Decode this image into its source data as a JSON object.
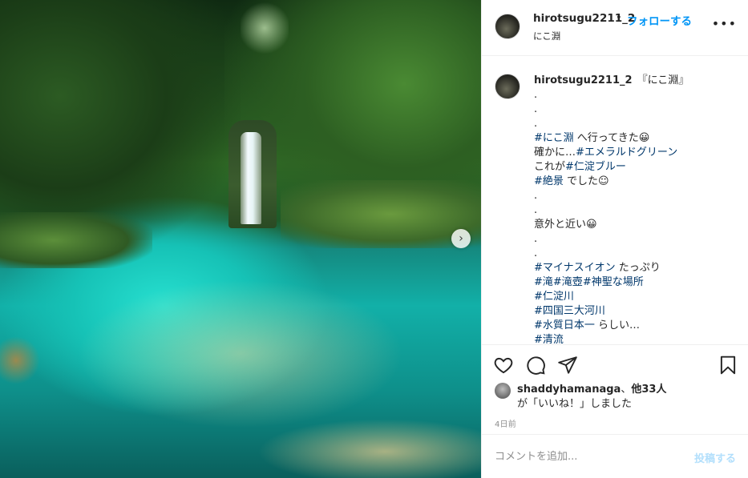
{
  "post": {
    "username": "hirotsugu2211_2",
    "separator": "•",
    "follow_label": "フォローする",
    "location": "にこ淵",
    "more_label": "•••",
    "next_label": "›"
  },
  "caption": {
    "username": "hirotsugu2211_2",
    "lines": [
      [
        {
          "t": "『にこ淵』",
          "tag": false
        }
      ],
      [
        {
          "t": ".",
          "tag": false
        }
      ],
      [
        {
          "t": ".",
          "tag": false
        }
      ],
      [
        {
          "t": ".",
          "tag": false
        }
      ],
      [
        {
          "t": "#にこ淵",
          "tag": true
        },
        {
          "t": " へ行ってきた😀",
          "tag": false
        }
      ],
      [
        {
          "t": "確かに…",
          "tag": false
        },
        {
          "t": "#エメラルドグリーン",
          "tag": true
        }
      ],
      [
        {
          "t": "これが",
          "tag": false
        },
        {
          "t": "#仁淀ブルー",
          "tag": true
        }
      ],
      [
        {
          "t": "#絶景",
          "tag": true
        },
        {
          "t": " でした☺",
          "tag": false
        }
      ],
      [
        {
          "t": ".",
          "tag": false
        }
      ],
      [
        {
          "t": ".",
          "tag": false
        }
      ],
      [
        {
          "t": "意外と近い😀",
          "tag": false
        }
      ],
      [
        {
          "t": ".",
          "tag": false
        }
      ],
      [
        {
          "t": ".",
          "tag": false
        }
      ],
      [
        {
          "t": "#マイナスイオン",
          "tag": true
        },
        {
          "t": " たっぷり",
          "tag": false
        }
      ],
      [
        {
          "t": "#滝",
          "tag": true
        },
        {
          "t": "#滝壺",
          "tag": true
        },
        {
          "t": "#神聖な場所",
          "tag": true
        }
      ],
      [
        {
          "t": "#仁淀川",
          "tag": true
        }
      ],
      [
        {
          "t": "#四国三大河川",
          "tag": true
        }
      ],
      [
        {
          "t": "#水質日本一",
          "tag": true
        },
        {
          "t": " らしい…",
          "tag": false
        }
      ],
      [
        {
          "t": "#清流",
          "tag": true
        }
      ]
    ]
  },
  "actions": {
    "like_icon": "heart-icon",
    "comment_icon": "comment-icon",
    "share_icon": "paper-plane-icon",
    "save_icon": "bookmark-icon"
  },
  "likes": {
    "liker": "shaddyhamanaga",
    "connector": "、",
    "others": "他33人",
    "suffix": "が「いいね！」しました"
  },
  "time_ago": "4日前",
  "comment": {
    "placeholder": "コメントを追加...",
    "post_label": "投稿する"
  },
  "colors": {
    "link_blue": "#0095f6",
    "hashtag": "#00376b",
    "post_disabled": "#b2dffc"
  }
}
